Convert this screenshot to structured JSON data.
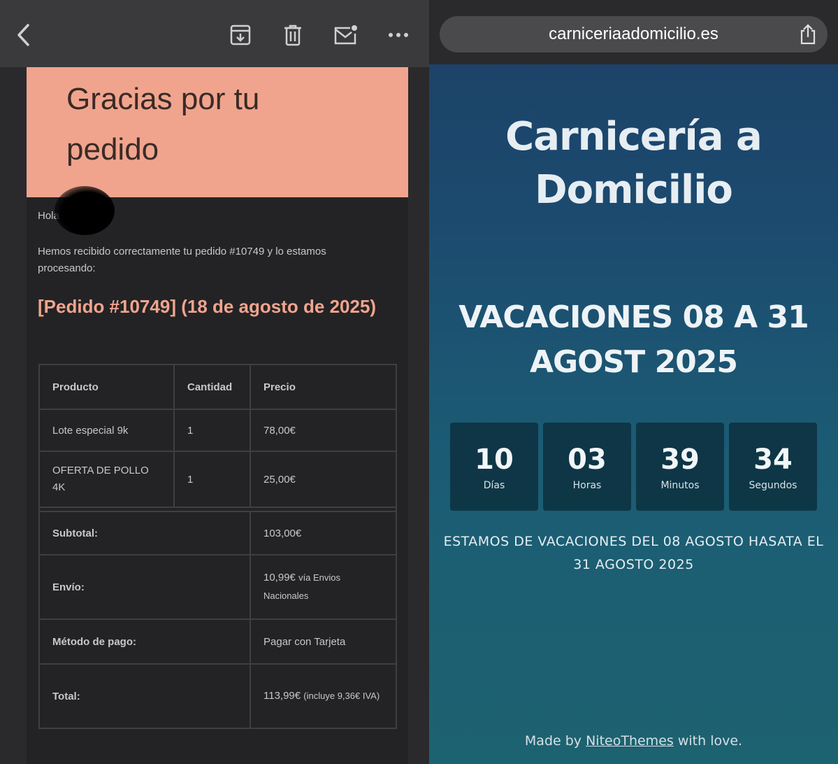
{
  "mail": {
    "hero_title": "Gracias por tu pedido",
    "greeting": "Hola",
    "intro": "Hemos recibido correctamente tu pedido #10749 y lo estamos procesando:",
    "order_heading": "[Pedido #10749] (18 de agosto de 2025)",
    "table": {
      "headers": [
        "Producto",
        "Cantidad",
        "Precio"
      ],
      "items": [
        {
          "product": "Lote especial 9k",
          "qty": "1",
          "price": "78,00€"
        },
        {
          "product": "OFERTA DE POLLO 4K",
          "qty": "1",
          "price": "25,00€"
        }
      ],
      "subtotal_label": "Subtotal:",
      "subtotal_value": "103,00€",
      "shipping_label": "Envío:",
      "shipping_value": "10,99€",
      "shipping_note": "vía Envios Nacionales",
      "payment_label": "Método de pago:",
      "payment_value": "Pagar con Tarjeta",
      "total_label": "Total:",
      "total_value": "113,99€",
      "total_note": "(incluye 9,36€ IVA)"
    },
    "toolbar_icons": [
      "back-chevron-icon",
      "archive-icon",
      "trash-icon",
      "mark-unread-icon",
      "more-icon"
    ]
  },
  "browser": {
    "url": "carniceriaadomicilio.es",
    "share_icon": "share-icon"
  },
  "site": {
    "title": "Carnicería a Domicilio",
    "vacation_title": "VACACIONES 08 A 31 AGOST 2025",
    "countdown": [
      {
        "value": "10",
        "label": "Días"
      },
      {
        "value": "03",
        "label": "Horas"
      },
      {
        "value": "39",
        "label": "Minutos"
      },
      {
        "value": "34",
        "label": "Segundos"
      }
    ],
    "message": "ESTAMOS DE VACACIONES DEL 08 AGOSTO HASATA EL 31 AGOSTO 2025",
    "footer_prefix": "Made by",
    "footer_link": "NiteoThemes",
    "footer_suffix": "with love."
  },
  "colors": {
    "hero_bg": "#f0a48e",
    "order_heading": "#f0a48e",
    "site_bg_top": "#1d3f66",
    "site_bg_bottom": "#1d6270"
  }
}
